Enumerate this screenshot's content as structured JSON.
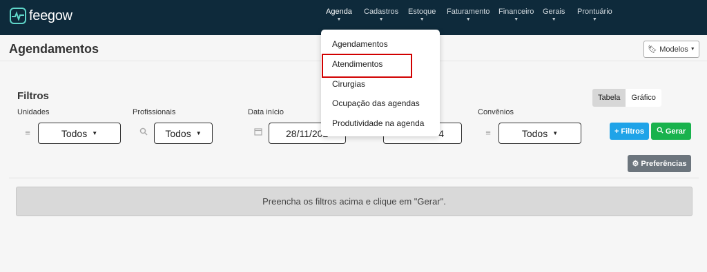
{
  "brand": {
    "name": "feegow"
  },
  "nav": {
    "items": [
      {
        "label": "Agenda"
      },
      {
        "label": "Cadastros"
      },
      {
        "label": "Estoque"
      },
      {
        "label": "Faturamento"
      },
      {
        "label": "Financeiro"
      },
      {
        "label": "Gerais"
      },
      {
        "label": "Prontuário"
      }
    ],
    "active": "Agenda"
  },
  "page": {
    "title": "Agendamentos",
    "modelos_label": "Modelos"
  },
  "dropdown": {
    "items": [
      {
        "label": "Agendamentos"
      },
      {
        "label": "Atendimentos"
      },
      {
        "label": "Cirurgias"
      },
      {
        "label": "Ocupação das agendas"
      },
      {
        "label": "Produtividade na agenda"
      }
    ],
    "highlighted": "Atendimentos"
  },
  "filters": {
    "title": "Filtros",
    "unidades": {
      "label": "Unidades",
      "value": "Todos"
    },
    "profissionais": {
      "label": "Profissionais",
      "value": "Todos"
    },
    "data_inicio": {
      "label": "Data início",
      "value": "28/11/202"
    },
    "data_fim": {
      "value": "4"
    },
    "convenios": {
      "label": "Convênios",
      "value": "Todos"
    }
  },
  "view_toggle": {
    "tabela": "Tabela",
    "grafico": "Gráfico",
    "selected": "Tabela"
  },
  "buttons": {
    "filtros": "Filtros",
    "gerar": "Gerar",
    "preferencias": "Preferências"
  },
  "alert": {
    "message": "Preencha os filtros acima e clique em \"Gerar\"."
  },
  "colors": {
    "topbar": "#0e2a3b",
    "accent_blue": "#1fa3e8",
    "accent_green": "#19b24d",
    "highlight_red": "#d10000"
  }
}
